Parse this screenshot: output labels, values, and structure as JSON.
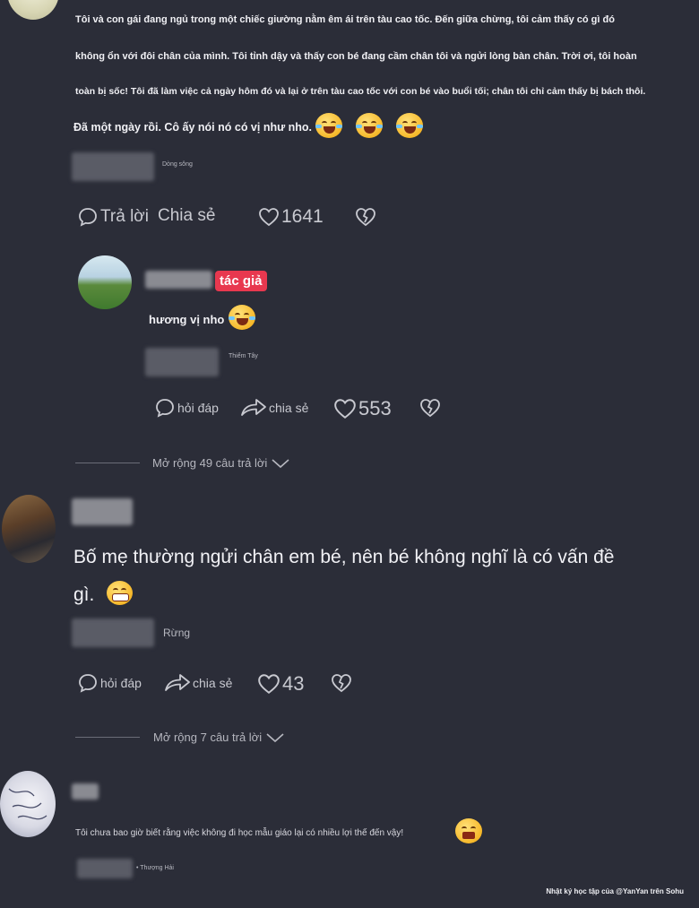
{
  "comments": [
    {
      "lines": [
        "Tôi và con gái đang ngủ trong một chiếc giường nằm êm ái trên tàu cao tốc. Đến giữa chừng, tôi cảm thấy có gì đó",
        "không ổn với đôi chân của mình. Tôi tỉnh dậy và thấy con bé đang cầm chân tôi và ngửi lòng bàn chân. Trời ơi, tôi hoàn",
        "toàn bị sốc! Tôi đã làm việc cả ngày hôm đó và lại ở trên tàu cao tốc với con bé vào buổi tối; chân tôi chỉ cảm thấy bị bách thôi.",
        "Đã một ngày rồi. Cô ấy nói nó có vị như nho."
      ],
      "location": "Dòng sông",
      "reply": "Trả lời",
      "share": "Chia sẻ",
      "likes": "1641"
    },
    {
      "badge": "tác giả",
      "text": "hương vị nho",
      "location": "Thiểm Tây",
      "reply": "hỏi đáp",
      "share": "chia sẻ",
      "likes": "553",
      "expand": "Mở rộng 49 câu trả lời"
    },
    {
      "line1": "Bố mẹ thường ngửi chân em bé, nên bé không nghĩ là có vấn đề",
      "line2": "gì.",
      "location": "Rừng",
      "reply": "hỏi đáp",
      "share": "chia sẻ",
      "likes": "43",
      "expand": "Mở rộng 7 câu trả lời"
    },
    {
      "text": "Tôi chưa bao giờ biết rằng việc không đi học mẫu giáo lại có nhiều lợi thế đến vậy!",
      "location": "Thượng Hải"
    }
  ],
  "watermark": "Nhật ký học tập của @YanYan trên Sohu"
}
